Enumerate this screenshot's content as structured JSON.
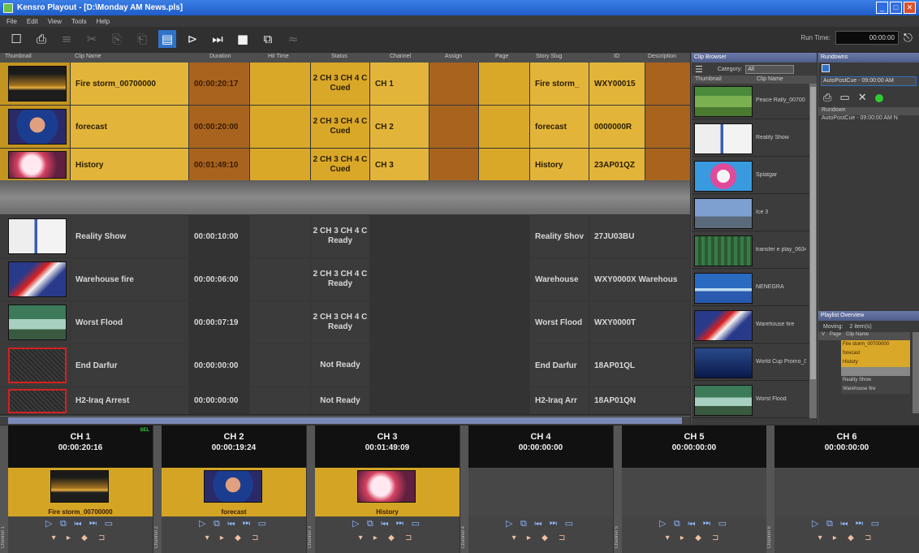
{
  "window": {
    "title": "Kensro Playout - [D:\\Monday AM News.pls]",
    "buttons": [
      "_",
      "□",
      "✕"
    ]
  },
  "menu": [
    "File",
    "Edit",
    "View",
    "Tools",
    "Help"
  ],
  "toolbar": {
    "run_time_label": "Run Time:",
    "run_time_value": "00:00:00"
  },
  "playlist": {
    "columns": [
      "Thumbnail",
      "Clip Name",
      "Duration",
      "Hit Time",
      "Status",
      "Channel",
      "Assign",
      "Page",
      "Story Slug",
      "ID",
      "Description"
    ],
    "cued_rows": [
      {
        "clip": "Fire storm_00700000",
        "duration": "00:00:20:17",
        "status_top": "2 CH 3 CH 4 C",
        "status": "Cued",
        "channel": "CH 1",
        "slug": "Fire storm_",
        "id": "WXY00015"
      },
      {
        "clip": "forecast",
        "duration": "00:00:20:00",
        "status_top": "2 CH 3 CH 4 C",
        "status": "Cued",
        "channel": "CH 2",
        "slug": "forecast",
        "id": "0000000R"
      },
      {
        "clip": "History",
        "duration": "00:01:49:10",
        "status_top": "2 CH 3 CH 4 C",
        "status": "Cued",
        "channel": "CH 3",
        "slug": "History",
        "id": "23AP01QZ"
      }
    ],
    "ready_rows": [
      {
        "clip": "Reality Show",
        "duration": "00:00:10:00",
        "status_top": "2 CH 3 CH 4 C",
        "status": "Ready",
        "slug": "Reality Shov",
        "id": "27JU03BU"
      },
      {
        "clip": "Warehouse fire",
        "duration": "00:00:06:00",
        "status_top": "2 CH 3 CH 4 C",
        "status": "Ready",
        "slug": "Warehouse",
        "id": "WXY0000X Warehous"
      },
      {
        "clip": "Worst Flood",
        "duration": "00:00:07:19",
        "status_top": "2 CH 3 CH 4 C",
        "status": "Ready",
        "slug": "Worst Flood",
        "id": "WXY0000T"
      },
      {
        "clip": "End Darfur",
        "duration": "00:00:00:00",
        "status_top": "",
        "status": "Not Ready",
        "slug": "End Darfur",
        "id": "18AP01QL"
      },
      {
        "clip": "H2-Iraq Arrest",
        "duration": "00:00:00:00",
        "status_top": "",
        "status": "Not Ready",
        "slug": "H2-Iraq Arr",
        "id": "18AP01QN"
      }
    ]
  },
  "clip_browser": {
    "title": "Clip Browser",
    "category_label": "Category:",
    "category_value": "All",
    "columns": [
      "Thumbnail",
      "Clip Name"
    ],
    "items": [
      "Peace Rally_00700",
      "Reality Show",
      "Splatgar",
      "Ice 3",
      "transfer e play_0634",
      "NENEGRA",
      "Warehouse fire",
      "World Cup Promo_00",
      "Worst Flood"
    ]
  },
  "right_panel": {
    "title": "Rundowns",
    "select_value": "AutoPostCue - 09:00:00 AM",
    "col": "Rundown",
    "row": "AutoPostCue - 09:00:00 AM   N",
    "overview_title": "Playlist Overview",
    "overview_label": "Moving:",
    "overview_value": "2 item(s)",
    "overview_cols": [
      "V",
      "Page",
      "Clip Name"
    ],
    "overview_rows": [
      "Fire storm_00700000",
      "forecast",
      "History",
      "",
      "Reality Show",
      "Warehouse fire"
    ]
  },
  "channels": [
    {
      "name": "CH 1",
      "time": "00:00:20:16",
      "clip": "Fire storm_00700000",
      "side": "Channel 1",
      "badge": "SEL"
    },
    {
      "name": "CH 2",
      "time": "00:00:19:24",
      "clip": "forecast",
      "side": "Channel 2",
      "badge": ""
    },
    {
      "name": "CH 3",
      "time": "00:01:49:09",
      "clip": "History",
      "side": "Channel 3",
      "badge": ""
    },
    {
      "name": "CH 4",
      "time": "00:00:00:00",
      "clip": "",
      "side": "Channel 4",
      "badge": ""
    },
    {
      "name": "CH 5",
      "time": "00:00:00:00",
      "clip": "",
      "side": "Channel 5",
      "badge": ""
    },
    {
      "name": "CH 6",
      "time": "00:00:00:00",
      "clip": "",
      "side": "Channel 6",
      "badge": ""
    }
  ],
  "channel_controls": "▷ ⧉ ⏮ ⏭ ▭",
  "channel_controls2": "▾ ▸ ◆ ⊐",
  "icons": [
    "new-icon",
    "import-icon",
    "play-icon",
    "skip-icon",
    "stop-icon",
    "camera-icon",
    "list-icon",
    "exit-icon"
  ]
}
